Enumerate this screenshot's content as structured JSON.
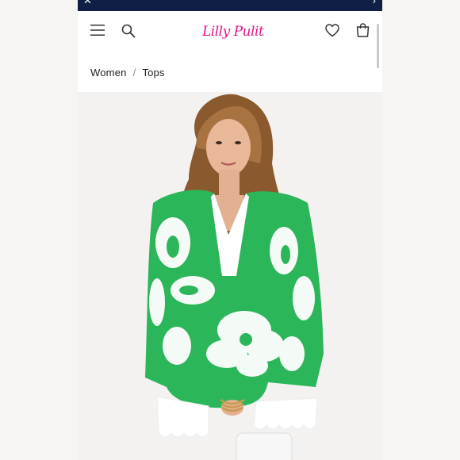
{
  "brand": {
    "logo_text": "Lilly Pulitzer",
    "accent_color": "#e5128a"
  },
  "topbar": {
    "close_icon": "close-icon",
    "arrow_icon": "chevron-right-icon",
    "background": "#0f1f45"
  },
  "header": {
    "icons": [
      "menu-icon",
      "search-icon",
      "heart-icon",
      "shopping-bag-icon"
    ]
  },
  "breadcrumb": {
    "items": [
      "Women",
      "Tops"
    ],
    "separator": "/"
  },
  "product": {
    "print_colors": [
      "#2cb65a",
      "#ffffff"
    ]
  }
}
